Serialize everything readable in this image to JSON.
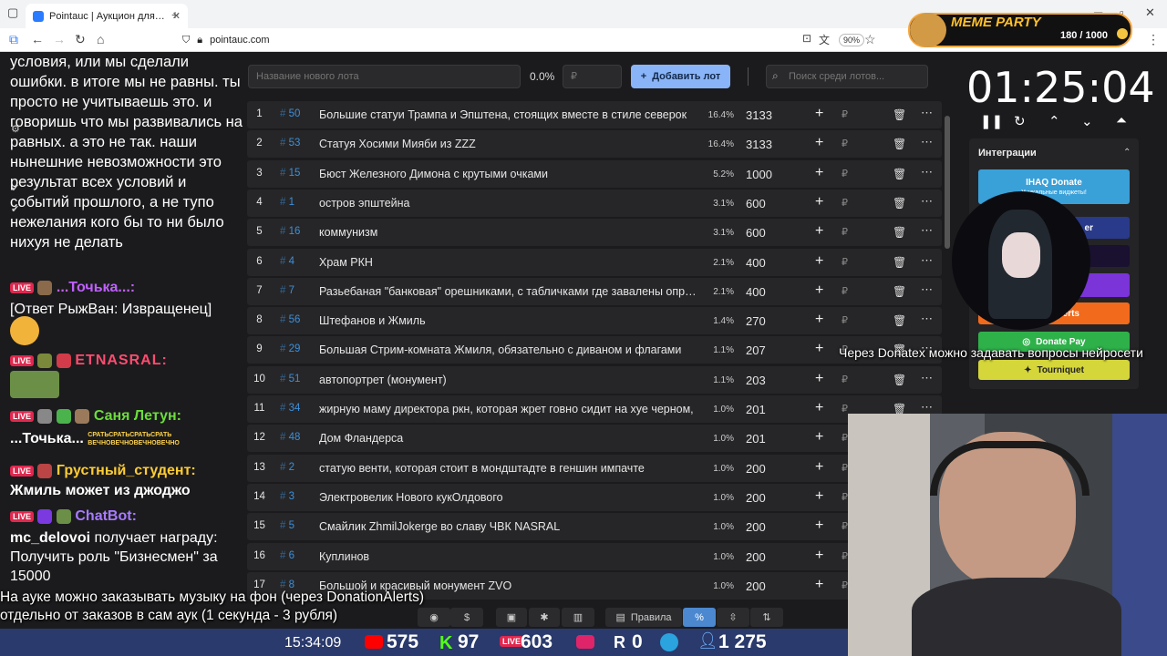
{
  "browser": {
    "tab_title": "Pointauc | Аукцион для стрима",
    "url": "pointauc.com",
    "zoom": "90%"
  },
  "chat": {
    "main_text": "условия, или мы сделали ошибки. в итоге мы не равны. ты просто не учитываешь это. и говоришь что мы развивались на равных. а это не так. наши нынешние невозможности это результат всех условий и событий прошлого, а не тупо нежелания кого бы то ни было нихуя не делать",
    "nick1": "...Точька...:",
    "reply1": "[Ответ РыжВан: Извращенец]",
    "nick2": "ETNASRAL:",
    "nick3": "Саня Летун:",
    "msg3": "...Точька...",
    "msg3_emote": "СРАТЬСРАТЬСРАТЬСРАТЬ ВЕЧНОВЕЧНОВЕЧНОВЕЧНО",
    "nick4": "Грустный_студент:",
    "msg4": "Жмиль может из джоджо",
    "nick5": "ChatBot:",
    "msg5_user": "mc_delovoi",
    "msg5_text": "получает награду: Получить роль \"Бизнесмен\" за 15000",
    "live": "LIVE"
  },
  "toolbar": {
    "lot_placeholder": "Название нового лота",
    "percent": "0.0%",
    "rub_placeholder": "₽",
    "add_label": "Добавить лот",
    "search_placeholder": "Поиск среди лотов..."
  },
  "lots": [
    {
      "idx": "1",
      "id": "50",
      "name": "Большие статуи Трампа и Эпштена, стоящих вместе в стиле северок",
      "pct": "16.4%",
      "amount": "3133"
    },
    {
      "idx": "2",
      "id": "53",
      "name": "Статуя Хосими Мияби из ZZZ",
      "pct": "16.4%",
      "amount": "3133"
    },
    {
      "idx": "3",
      "id": "15",
      "name": "Бюст Железного Димона с крутыми очками",
      "pct": "5.2%",
      "amount": "1000"
    },
    {
      "idx": "4",
      "id": "1",
      "name": "остров эпштейна",
      "pct": "3.1%",
      "amount": "600"
    },
    {
      "idx": "5",
      "id": "16",
      "name": "коммунизм",
      "pct": "3.1%",
      "amount": "600"
    },
    {
      "idx": "6",
      "id": "4",
      "name": "Храм РКН",
      "pct": "2.1%",
      "amount": "400"
    },
    {
      "idx": "7",
      "id": "7",
      "name": "Разьебаная \"банковая\" орешниками, с табличками где завалены опред",
      "pct": "2.1%",
      "amount": "400"
    },
    {
      "idx": "8",
      "id": "56",
      "name": "Штефанов и Жмиль",
      "pct": "1.4%",
      "amount": "270"
    },
    {
      "idx": "9",
      "id": "29",
      "name": "Большая Стрим-комната Жмиля, обязательно с диваном и флагами",
      "pct": "1.1%",
      "amount": "207"
    },
    {
      "idx": "10",
      "id": "51",
      "name": "автопортрет (монумент)",
      "pct": "1.1%",
      "amount": "203"
    },
    {
      "idx": "11",
      "id": "34",
      "name": "жирную маму директора ркн, которая жрет говно сидит на хуе черном,",
      "pct": "1.0%",
      "amount": "201"
    },
    {
      "idx": "12",
      "id": "48",
      "name": "Дом Фландерса",
      "pct": "1.0%",
      "amount": "201"
    },
    {
      "idx": "13",
      "id": "2",
      "name": "статую венти, которая стоит в мондштадте в геншин импачте",
      "pct": "1.0%",
      "amount": "200"
    },
    {
      "idx": "14",
      "id": "3",
      "name": "Электровелик Нового кукОлдового",
      "pct": "1.0%",
      "amount": "200"
    },
    {
      "idx": "15",
      "id": "5",
      "name": "Смайлик ZhmilJokerge во славу ЧВК NASRAL",
      "pct": "1.0%",
      "amount": "200"
    },
    {
      "idx": "16",
      "id": "6",
      "name": "Куплинов",
      "pct": "1.0%",
      "amount": "200"
    },
    {
      "idx": "17",
      "id": "8",
      "name": "Большой и красивый монумент ZVO",
      "pct": "1.0%",
      "amount": "200"
    }
  ],
  "bottom": {
    "rules": "Правила",
    "percent": "%"
  },
  "timer": {
    "value": "01:25:04"
  },
  "integrations": {
    "title": "Интеграции",
    "ihaq": "IHAQ Donate",
    "ihaq_sub": "Уникальные виджеты!",
    "er": "er",
    "alerts": "Alerts",
    "donatepay": "Donate Pay",
    "tourniquet": "Tourniquet"
  },
  "meme": {
    "title": "MEME PARTY",
    "count": "180 / 1000"
  },
  "overlay": {
    "donatex": "Через Donatex можно задавать вопросы нейросети",
    "music1": "На ауке можно заказывать музыку на фон (через DonationAlerts)",
    "music2": "отдельно от заказов в сам аук (1 секунда - 3 рубля)"
  },
  "status": {
    "time": "15:34:09",
    "youtube": "575",
    "kick": "97",
    "live": "603",
    "rutube": "0",
    "viewers": "1 275"
  },
  "colors": {
    "accent": "#8ab4f8",
    "id_blue": "#3d8fd9",
    "row_bg": "#262628"
  }
}
